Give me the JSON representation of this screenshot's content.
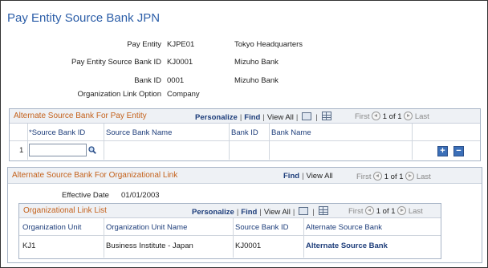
{
  "page": {
    "title": "Pay Entity Source Bank JPN"
  },
  "fields": [
    {
      "label": "Pay Entity",
      "value": "KJPE01",
      "desc": "Tokyo Headquarters"
    },
    {
      "label": "Pay Entity Source Bank ID",
      "value": "KJ0001",
      "desc": "Mizuho Bank"
    },
    {
      "label": "Bank ID",
      "value": "0001",
      "desc": "Mizuho Bank"
    },
    {
      "label": "Organization Link Option",
      "value": "Company",
      "desc": ""
    }
  ],
  "grid1": {
    "title": "Alternate Source Bank For Pay Entity",
    "personalize": "Personalize",
    "find": "Find",
    "view_all": "View All",
    "first": "First",
    "range": "1 of 1",
    "last": "Last",
    "columns": [
      "*Source Bank ID",
      "Source Bank Name",
      "Bank ID",
      "Bank Name"
    ],
    "rows": [
      {
        "num": "1",
        "source_bank_id": "",
        "source_bank_name": "",
        "bank_id": "",
        "bank_name": ""
      }
    ],
    "add_label": "+",
    "delete_label": "−"
  },
  "group2": {
    "title": "Alternate Source Bank For Organizational Link",
    "find": "Find",
    "view_all": "View All",
    "first": "First",
    "range": "1 of 1",
    "last": "Last",
    "effective_date_label": "Effective Date",
    "effective_date": "01/01/2003",
    "list": {
      "title": "Organizational Link List",
      "personalize": "Personalize",
      "find": "Find",
      "view_all": "View All",
      "first": "First",
      "range": "1 of 1",
      "last": "Last",
      "columns": [
        "Organization Unit",
        "Organization Unit Name",
        "Source Bank ID",
        "Alternate Source Bank"
      ],
      "rows": [
        {
          "org_unit": "KJ1",
          "org_unit_name": "Business Institute - Japan",
          "source_bank_id": "KJ0001",
          "alt_source_bank": "Alternate Source Bank"
        }
      ]
    }
  },
  "colors": {
    "title_blue": "#2c5ea8",
    "section_orange": "#c4611b",
    "link_blue": "#1d3d7a"
  },
  "icons": [
    "view-all-zoom-icon",
    "grid-download-icon",
    "first-arrow-icon",
    "last-arrow-icon",
    "lookup-lens-icon",
    "add-row-icon",
    "delete-row-icon"
  ]
}
